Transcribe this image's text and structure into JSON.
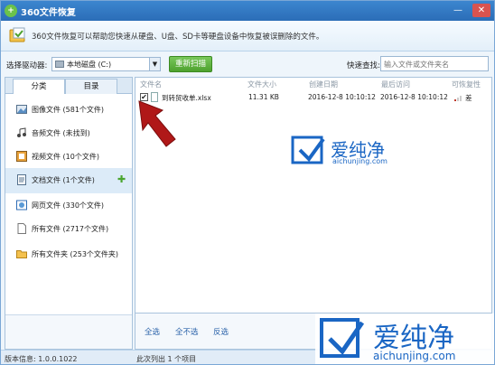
{
  "window": {
    "title": "360文件恢复",
    "min_glyph": "—",
    "close_glyph": "✕"
  },
  "banner": {
    "text": "360文件恢复可以帮助您快速从硬盘、U盘、SD卡等硬盘设备中恢复被误删除的文件。"
  },
  "toolbar": {
    "drive_label": "选择驱动器:",
    "drive_value": "本地磁盘 (C:)",
    "scan_label": "重新扫描",
    "search_label": "快速查找:",
    "search_placeholder": "输入文件或文件夹名"
  },
  "sidebar": {
    "tabs": [
      "分类",
      "目录"
    ],
    "categories": [
      {
        "label": "图像文件 (581个文件)",
        "icon": "image-icon"
      },
      {
        "label": "音频文件 (未找到)",
        "icon": "music-icon"
      },
      {
        "label": "视频文件 (10个文件)",
        "icon": "video-icon"
      },
      {
        "label": "文档文件 (1个文件)",
        "icon": "document-icon"
      },
      {
        "label": "网页文件 (330个文件)",
        "icon": "webpage-icon"
      },
      {
        "label": "所有文件 (2717个文件)",
        "icon": "file-icon"
      },
      {
        "label": "所有文件夹 (253个文件夹)",
        "icon": "folder-icon"
      }
    ],
    "selected_index": 3,
    "add_glyph": "✚"
  },
  "filelist": {
    "columns": [
      "文件名",
      "文件大小",
      "创建日期",
      "最后访问",
      "可恢复性"
    ],
    "rows": [
      {
        "checked": true,
        "check_glyph": "✔",
        "name": "到转贸收单.xlsx",
        "size": "11.31 KB",
        "created": "2016-12-8 10:10:12",
        "accessed": "2016-12-8 10:10:12",
        "recoverability": "差"
      }
    ]
  },
  "actions": {
    "select_all": "全选",
    "select_none": "全不选",
    "invert": "反选"
  },
  "status": {
    "version": "版本信息: 1.0.0.1022",
    "summary": "此次列出 1 个项目"
  },
  "watermark_top": {
    "title": "爱纯净",
    "url": "aichunjing.com"
  },
  "watermark_bottom": {
    "title": "爱纯净",
    "url": "aichunjing.com"
  },
  "colors": {
    "titlebar": "#2b6db7",
    "accent_green": "#4ea12f",
    "watermark_blue": "#1a66c4",
    "arrow_red": "#b01818"
  }
}
